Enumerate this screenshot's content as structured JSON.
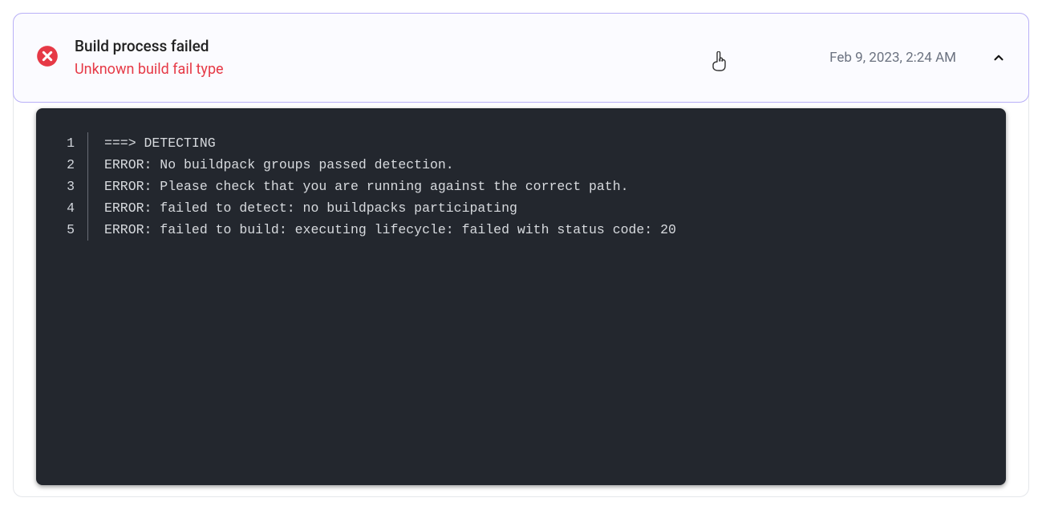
{
  "header": {
    "title": "Build process failed",
    "subtitle": "Unknown build fail type",
    "timestamp": "Feb 9, 2023, 2:24 AM"
  },
  "log": {
    "lines": [
      {
        "num": "1",
        "text": "===> DETECTING"
      },
      {
        "num": "2",
        "text": "ERROR: No buildpack groups passed detection."
      },
      {
        "num": "3",
        "text": "ERROR: Please check that you are running against the correct path."
      },
      {
        "num": "4",
        "text": "ERROR: failed to detect: no buildpacks participating"
      },
      {
        "num": "5",
        "text": "ERROR: failed to build: executing lifecycle: failed with status code: 20"
      }
    ]
  },
  "colors": {
    "error": "#e63946",
    "border": "#b9b0f7",
    "log_bg": "#23272e"
  }
}
